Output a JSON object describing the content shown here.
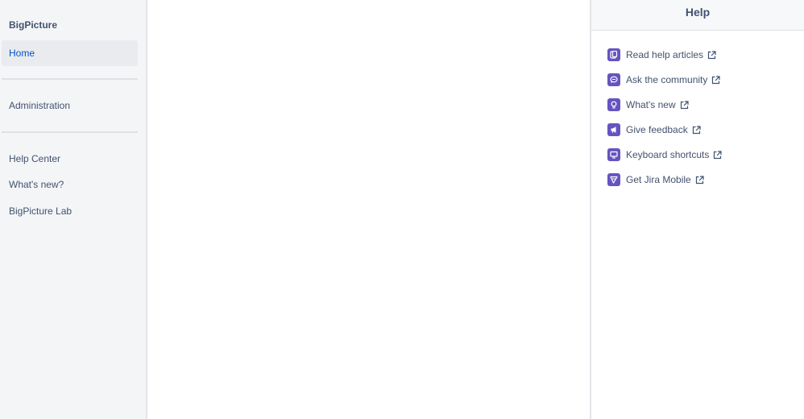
{
  "sidebar": {
    "title": "BigPicture",
    "items": [
      {
        "label": "Home",
        "active": true
      },
      {
        "label": "Administration",
        "active": false
      },
      {
        "label": "Help Center",
        "active": false
      },
      {
        "label": "What's new?",
        "active": false
      },
      {
        "label": "BigPicture Lab",
        "active": false
      }
    ]
  },
  "help": {
    "title": "Help",
    "items": [
      {
        "label": "Read help articles",
        "icon": "document-icon"
      },
      {
        "label": "Ask the community",
        "icon": "chat-icon"
      },
      {
        "label": "What's new",
        "icon": "lightbulb-icon"
      },
      {
        "label": "Give feedback",
        "icon": "megaphone-icon"
      },
      {
        "label": "Keyboard shortcuts",
        "icon": "monitor-icon"
      },
      {
        "label": "Get Jira Mobile",
        "icon": "send-icon"
      }
    ]
  },
  "colors": {
    "accent": "#0052cc",
    "help_icon_bg": "#6554c0",
    "sidebar_bg": "#f4f5f7"
  }
}
